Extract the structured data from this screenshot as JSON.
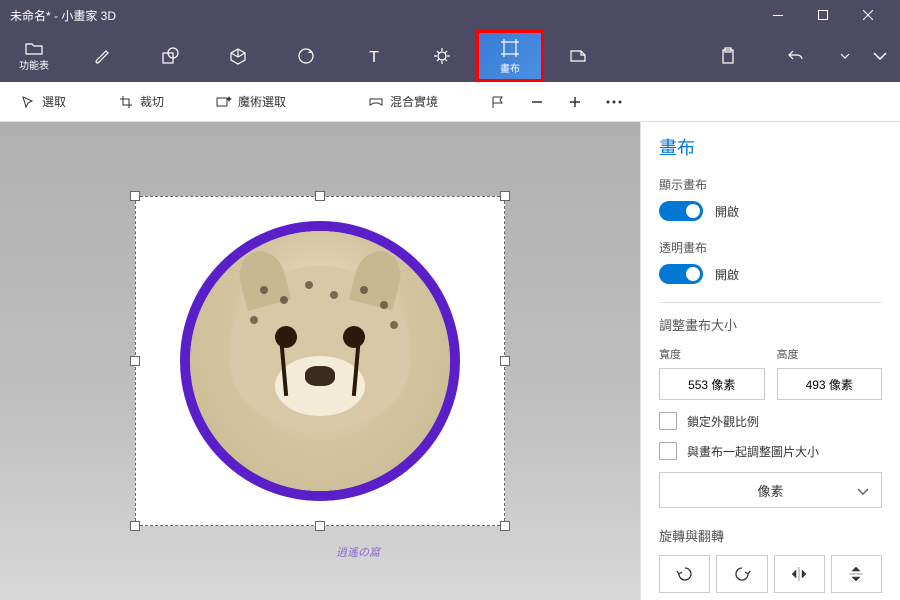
{
  "titlebar": {
    "title": "未命名* - 小畫家 3D"
  },
  "ribbon": {
    "main_label": "功能表",
    "canvas_label": "畫布"
  },
  "toolbar": {
    "select": "選取",
    "crop": "裁切",
    "magic": "魔術選取",
    "mixed": "混合實境"
  },
  "panel": {
    "title": "畫布",
    "show_canvas_label": "顯示畫布",
    "show_canvas_state": "開啟",
    "transparent_label": "透明畫布",
    "transparent_state": "開啟",
    "resize_title": "調整畫布大小",
    "width_label": "寬度",
    "height_label": "高度",
    "width_value": "553 像素",
    "height_value": "493 像素",
    "lock_aspect": "鎖定外觀比例",
    "resize_image": "與畫布一起調整圖片大小",
    "unit": "像素",
    "rotate_title": "旋轉與翻轉"
  }
}
